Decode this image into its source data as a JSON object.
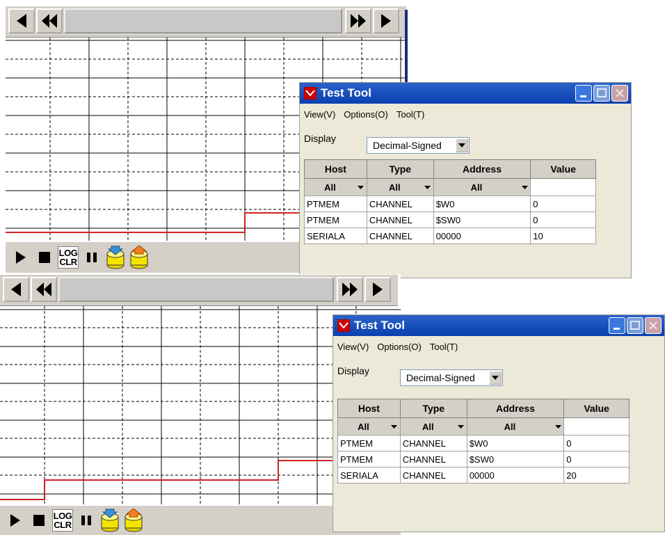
{
  "panels": [
    {
      "dialog": {
        "title": "Test Tool",
        "menu": [
          "View(V)",
          "Options(O)",
          "Tool(T)"
        ],
        "display_label": "Display",
        "display_value": "Decimal-Signed",
        "columns": [
          "Host",
          "Type",
          "Address",
          "Value"
        ],
        "filters": [
          "All",
          "All",
          "All",
          ""
        ],
        "rows": [
          [
            "PTMEM",
            "CHANNEL",
            "$W0",
            "0"
          ],
          [
            "PTMEM",
            "CHANNEL",
            "$SW0",
            "0"
          ],
          [
            "SERIALA",
            "CHANNEL",
            "00000",
            "10"
          ]
        ]
      },
      "toolbar": {
        "log_top": "LOG",
        "log_bottom": "CLR"
      }
    },
    {
      "dialog": {
        "title": "Test Tool",
        "menu": [
          "View(V)",
          "Options(O)",
          "Tool(T)"
        ],
        "display_label": "Display",
        "display_value": "Decimal-Signed",
        "columns": [
          "Host",
          "Type",
          "Address",
          "Value"
        ],
        "filters": [
          "All",
          "All",
          "All",
          ""
        ],
        "rows": [
          [
            "PTMEM",
            "CHANNEL",
            "$W0",
            "0"
          ],
          [
            "PTMEM",
            "CHANNEL",
            "$SW0",
            "0"
          ],
          [
            "SERIALA",
            "CHANNEL",
            "00000",
            "20"
          ]
        ]
      },
      "toolbar": {
        "log_top": "LOG",
        "log_bottom": "CLR"
      }
    }
  ],
  "colors": {
    "signal": "#cc2222",
    "titlebar": "#0a3fb0",
    "panel": "#d4d0c8"
  }
}
